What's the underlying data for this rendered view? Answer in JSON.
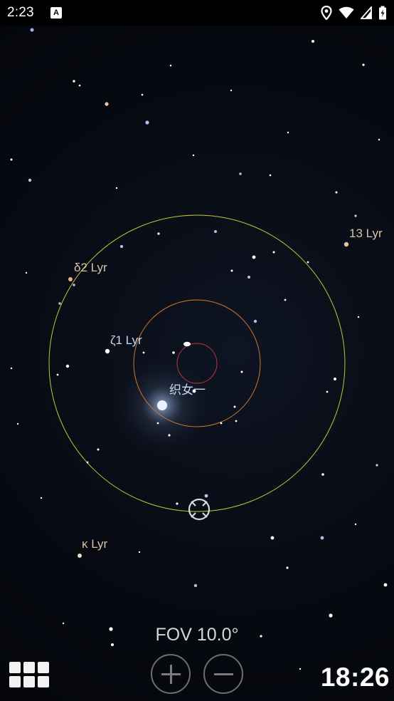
{
  "status_bar": {
    "time": "2:23",
    "notification_icon": "a-letter-icon",
    "icons": [
      "location-icon",
      "wifi-icon",
      "signal-icon",
      "battery-charging-icon"
    ]
  },
  "sky": {
    "labels": {
      "delta2_lyr": "δ2 Lyr",
      "zeta1_lyr": "ζ1 Lyr",
      "vega": "织女一",
      "thirteen_lyr": "13 Lyr",
      "kappa_lyr": "κ Lyr"
    },
    "colors": {
      "outer_circle": "#c8c23a",
      "middle_circle": "#c97a2e",
      "inner_circle": "#b33a3a",
      "warm_label": "#d8c2a8",
      "cool_label": "#c8d8ee"
    }
  },
  "controls": {
    "fov": "FOV 10.0°",
    "zoom_in_icon": "plus-icon",
    "zoom_out_icon": "minus-icon",
    "menu_icon": "grid-menu-icon",
    "clock": "18:26"
  }
}
